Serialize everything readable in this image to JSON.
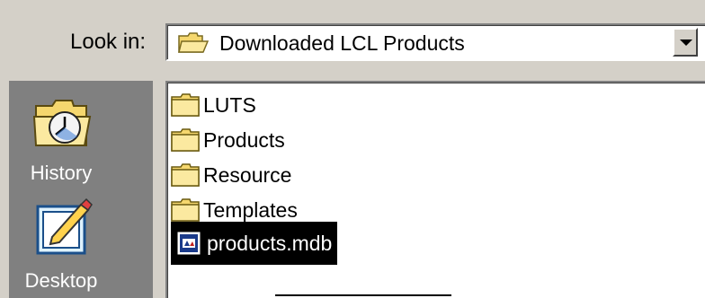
{
  "look_in": {
    "label": "Look in:",
    "value": "Downloaded LCL Products"
  },
  "places_bar": {
    "items": [
      {
        "label": "History",
        "icon": "history-icon"
      },
      {
        "label": "Desktop",
        "icon": "desktop-icon"
      }
    ]
  },
  "file_list": {
    "items": [
      {
        "name": "LUTS",
        "type": "folder",
        "selected": false
      },
      {
        "name": "Products",
        "type": "folder",
        "selected": false
      },
      {
        "name": "Resource",
        "type": "folder",
        "selected": false
      },
      {
        "name": "Templates",
        "type": "folder",
        "selected": false
      },
      {
        "name": "products.mdb",
        "type": "access-database",
        "selected": true
      }
    ]
  },
  "colors": {
    "dialog_bg": "#d4d0c8",
    "places_bg": "#808080",
    "selection_bg": "#000000",
    "folder_yellow": "#f5d76e"
  }
}
